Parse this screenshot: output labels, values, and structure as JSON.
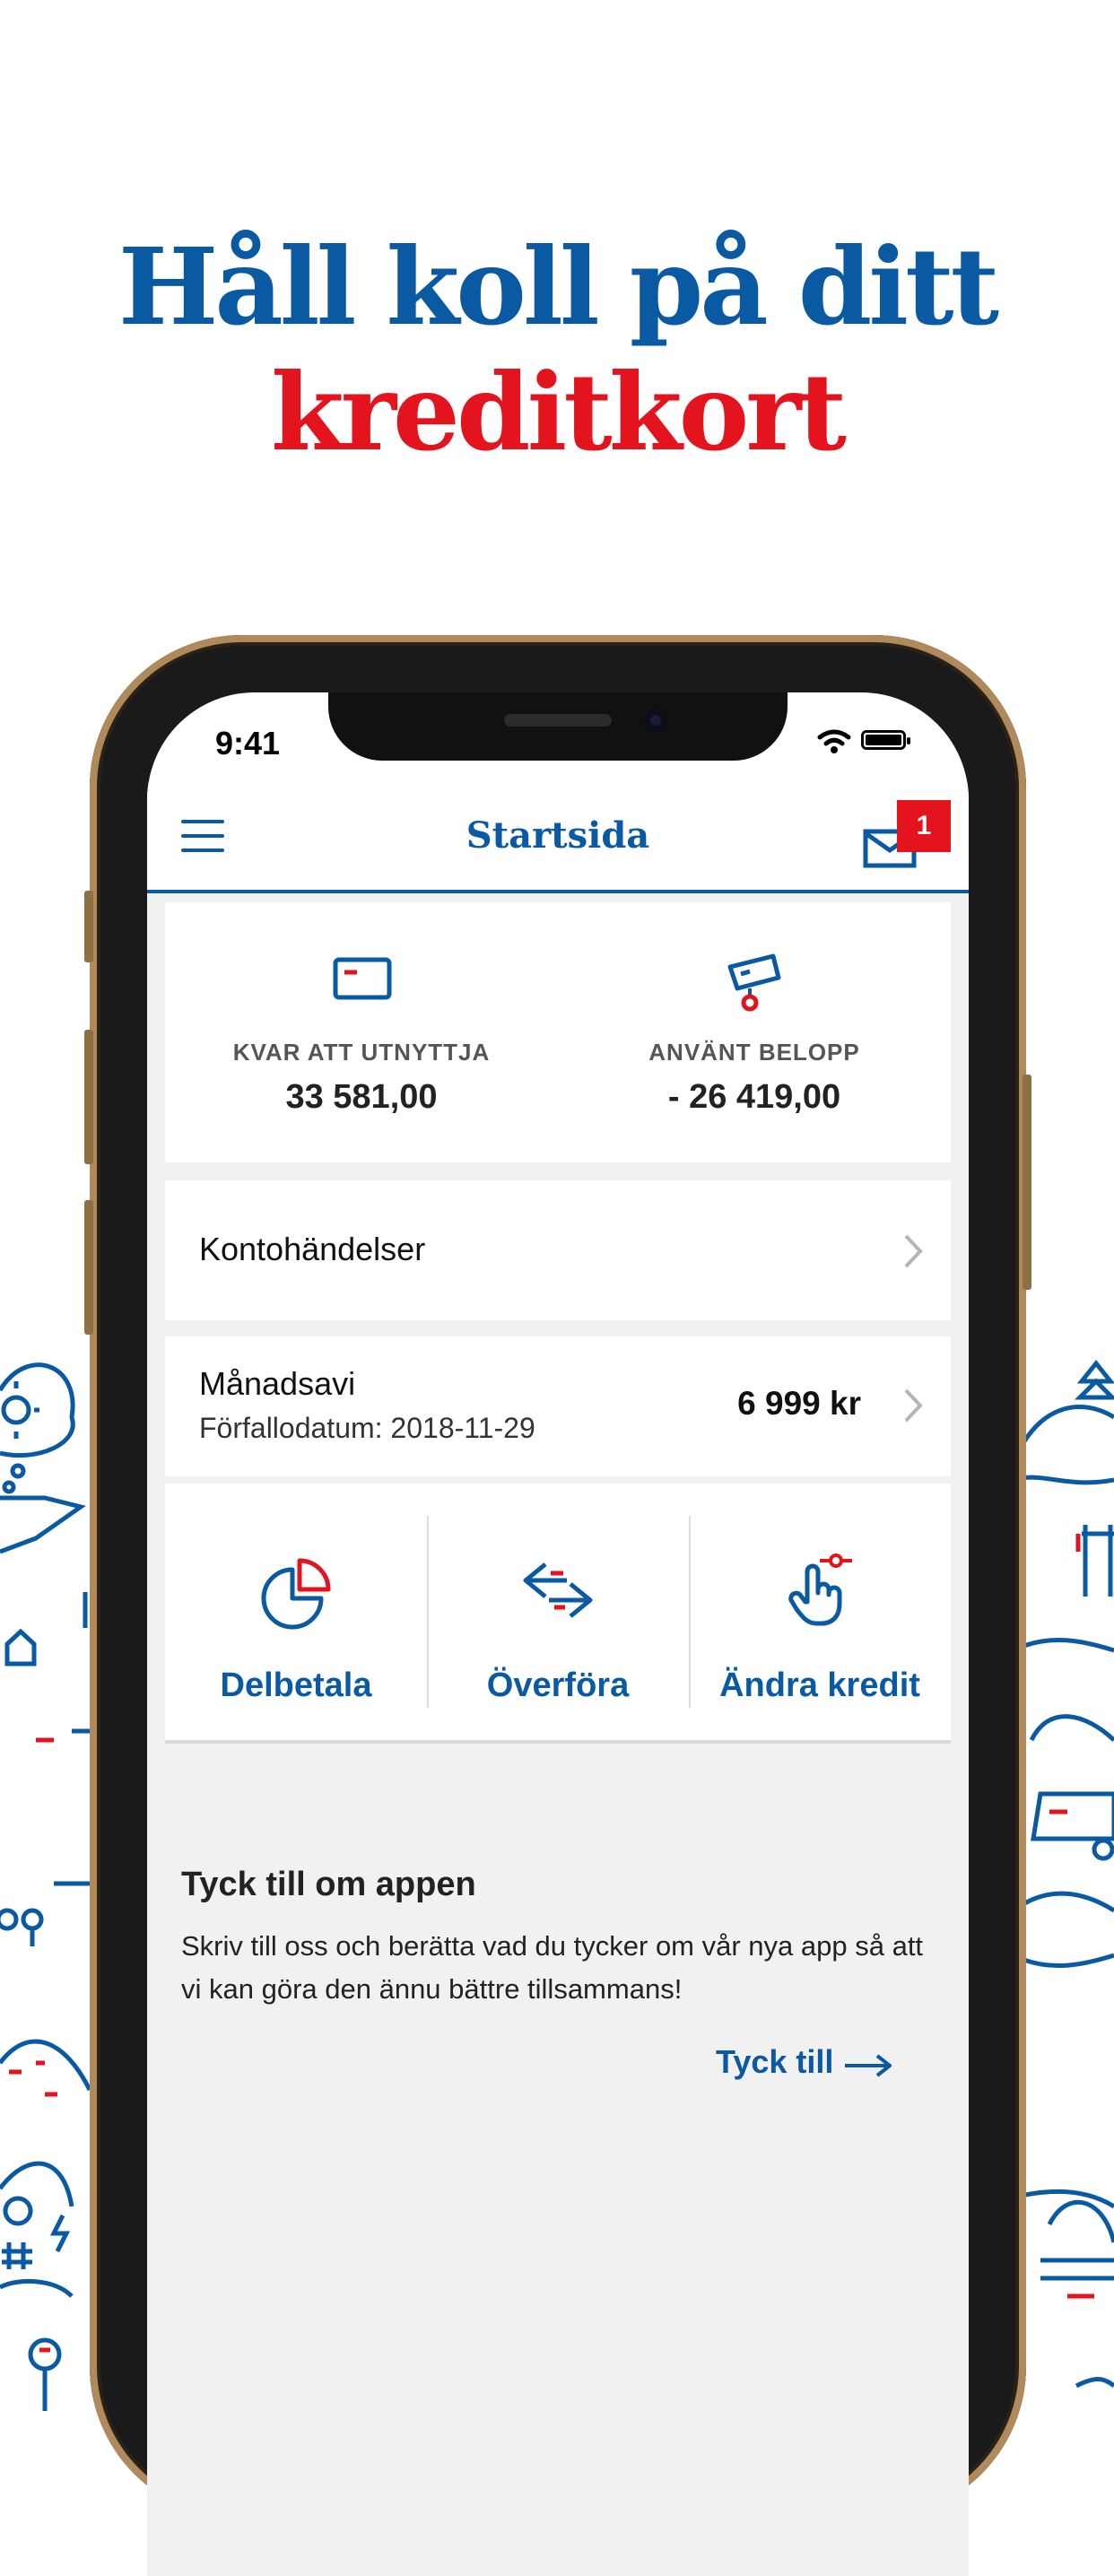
{
  "headline": {
    "line1": "Håll koll på ditt",
    "line2": "kreditkort"
  },
  "colors": {
    "brand_blue": "#0a59a3",
    "accent_red": "#e3141e",
    "background": "#f1f1f1"
  },
  "status_bar": {
    "time": "9:41"
  },
  "app_bar": {
    "title": "Startsida",
    "mail_badge": "1"
  },
  "summary": {
    "available": {
      "label": "KVAR ATT UTNYTTJA",
      "value": "33 581,00",
      "icon": "credit-card-icon"
    },
    "used": {
      "label": "ANVÄNT BELOPP",
      "value": "- 26 419,00",
      "icon": "cards-icon"
    }
  },
  "account_events": {
    "label": "Kontohändelser"
  },
  "monthly_statement": {
    "title": "Månadsavi",
    "due_date": "Förfallodatum: 2018-11-29",
    "amount": "6 999 kr"
  },
  "actions": [
    {
      "label": "Delbetala",
      "icon": "pie-chart-icon"
    },
    {
      "label": "Överföra",
      "icon": "transfer-arrows-icon"
    },
    {
      "label": "Ändra kredit",
      "icon": "hand-slider-icon"
    }
  ],
  "feedback": {
    "title": "Tyck till om appen",
    "text": "Skriv till oss och berätta vad du tycker om vår nya app så att vi kan göra den ännu bättre tillsammans!",
    "link": "Tyck till"
  }
}
